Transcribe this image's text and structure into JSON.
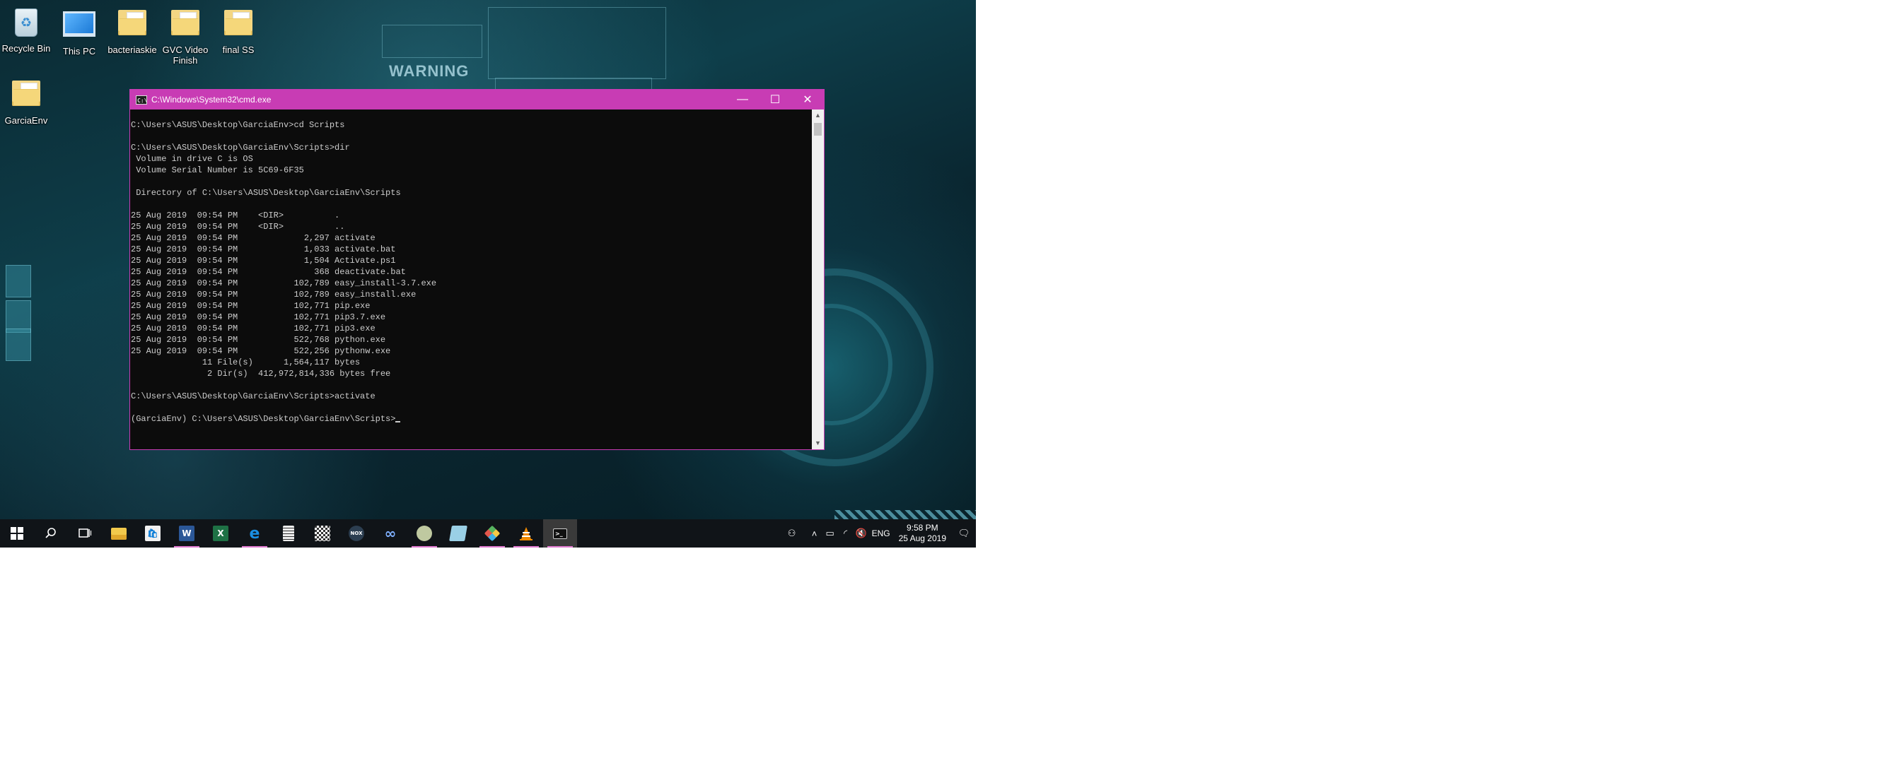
{
  "desktop": {
    "background_text": "WARNING",
    "icons": [
      {
        "label": "Recycle Bin",
        "icon": "recycle-bin-icon"
      },
      {
        "label": "This PC",
        "icon": "this-pc-icon"
      },
      {
        "label": "bacteriaskie",
        "icon": "folder-icon"
      },
      {
        "label": "GVC Video Finish",
        "icon": "folder-icon"
      },
      {
        "label": "final SS",
        "icon": "folder-icon"
      },
      {
        "label": "GarciaEnv",
        "icon": "folder-icon"
      }
    ]
  },
  "cmd": {
    "title": "C:\\Windows\\System32\\cmd.exe",
    "accent_color": "#c83cb4",
    "lines": [
      "C:\\Users\\ASUS\\Desktop\\GarciaEnv>cd Scripts",
      "",
      "C:\\Users\\ASUS\\Desktop\\GarciaEnv\\Scripts>dir",
      " Volume in drive C is OS",
      " Volume Serial Number is 5C69-6F35",
      "",
      " Directory of C:\\Users\\ASUS\\Desktop\\GarciaEnv\\Scripts",
      "",
      "25 Aug 2019  09:54 PM    <DIR>          .",
      "25 Aug 2019  09:54 PM    <DIR>          ..",
      "25 Aug 2019  09:54 PM             2,297 activate",
      "25 Aug 2019  09:54 PM             1,033 activate.bat",
      "25 Aug 2019  09:54 PM             1,504 Activate.ps1",
      "25 Aug 2019  09:54 PM               368 deactivate.bat",
      "25 Aug 2019  09:54 PM           102,789 easy_install-3.7.exe",
      "25 Aug 2019  09:54 PM           102,789 easy_install.exe",
      "25 Aug 2019  09:54 PM           102,771 pip.exe",
      "25 Aug 2019  09:54 PM           102,771 pip3.7.exe",
      "25 Aug 2019  09:54 PM           102,771 pip3.exe",
      "25 Aug 2019  09:54 PM           522,768 python.exe",
      "25 Aug 2019  09:54 PM           522,256 pythonw.exe",
      "              11 File(s)      1,564,117 bytes",
      "               2 Dir(s)  412,972,814,336 bytes free",
      "",
      "C:\\Users\\ASUS\\Desktop\\GarciaEnv\\Scripts>activate",
      ""
    ],
    "prompt": "(GarciaEnv) C:\\Users\\ASUS\\Desktop\\GarciaEnv\\Scripts>"
  },
  "taskbar": {
    "apps": [
      {
        "name": "search",
        "icon": "search-icon"
      },
      {
        "name": "task-view",
        "icon": "task-view-icon"
      },
      {
        "name": "file-explorer",
        "icon": "folder-icon"
      },
      {
        "name": "store",
        "icon": "store-icon"
      },
      {
        "name": "word",
        "icon": "word-icon",
        "glyph": "W",
        "color": "#2b5797",
        "open": true
      },
      {
        "name": "excel",
        "icon": "excel-icon",
        "glyph": "X",
        "color": "#1e7145"
      },
      {
        "name": "edge",
        "icon": "edge-icon",
        "glyph": "e",
        "color": "#0078d7",
        "open": true
      },
      {
        "name": "calculator",
        "icon": "calculator-icon"
      },
      {
        "name": "qr-app",
        "icon": "qr-icon"
      },
      {
        "name": "nox",
        "icon": "nox-icon",
        "glyph": "NOX",
        "color": "#2c3e50"
      },
      {
        "name": "link-app",
        "icon": "link-icon",
        "glyph": "∞",
        "color": "#1a2a6c"
      },
      {
        "name": "tortoise",
        "icon": "tortoise-icon",
        "open": true
      },
      {
        "name": "notes",
        "icon": "notes-icon"
      },
      {
        "name": "paint",
        "icon": "paint-icon",
        "open": true
      },
      {
        "name": "vlc",
        "icon": "vlc-icon",
        "open": true
      },
      {
        "name": "cmd",
        "icon": "cmd-icon",
        "open": true,
        "active": true
      }
    ],
    "tray": {
      "language": "ENG",
      "time": "9:58 PM",
      "date": "25 Aug 2019"
    }
  }
}
